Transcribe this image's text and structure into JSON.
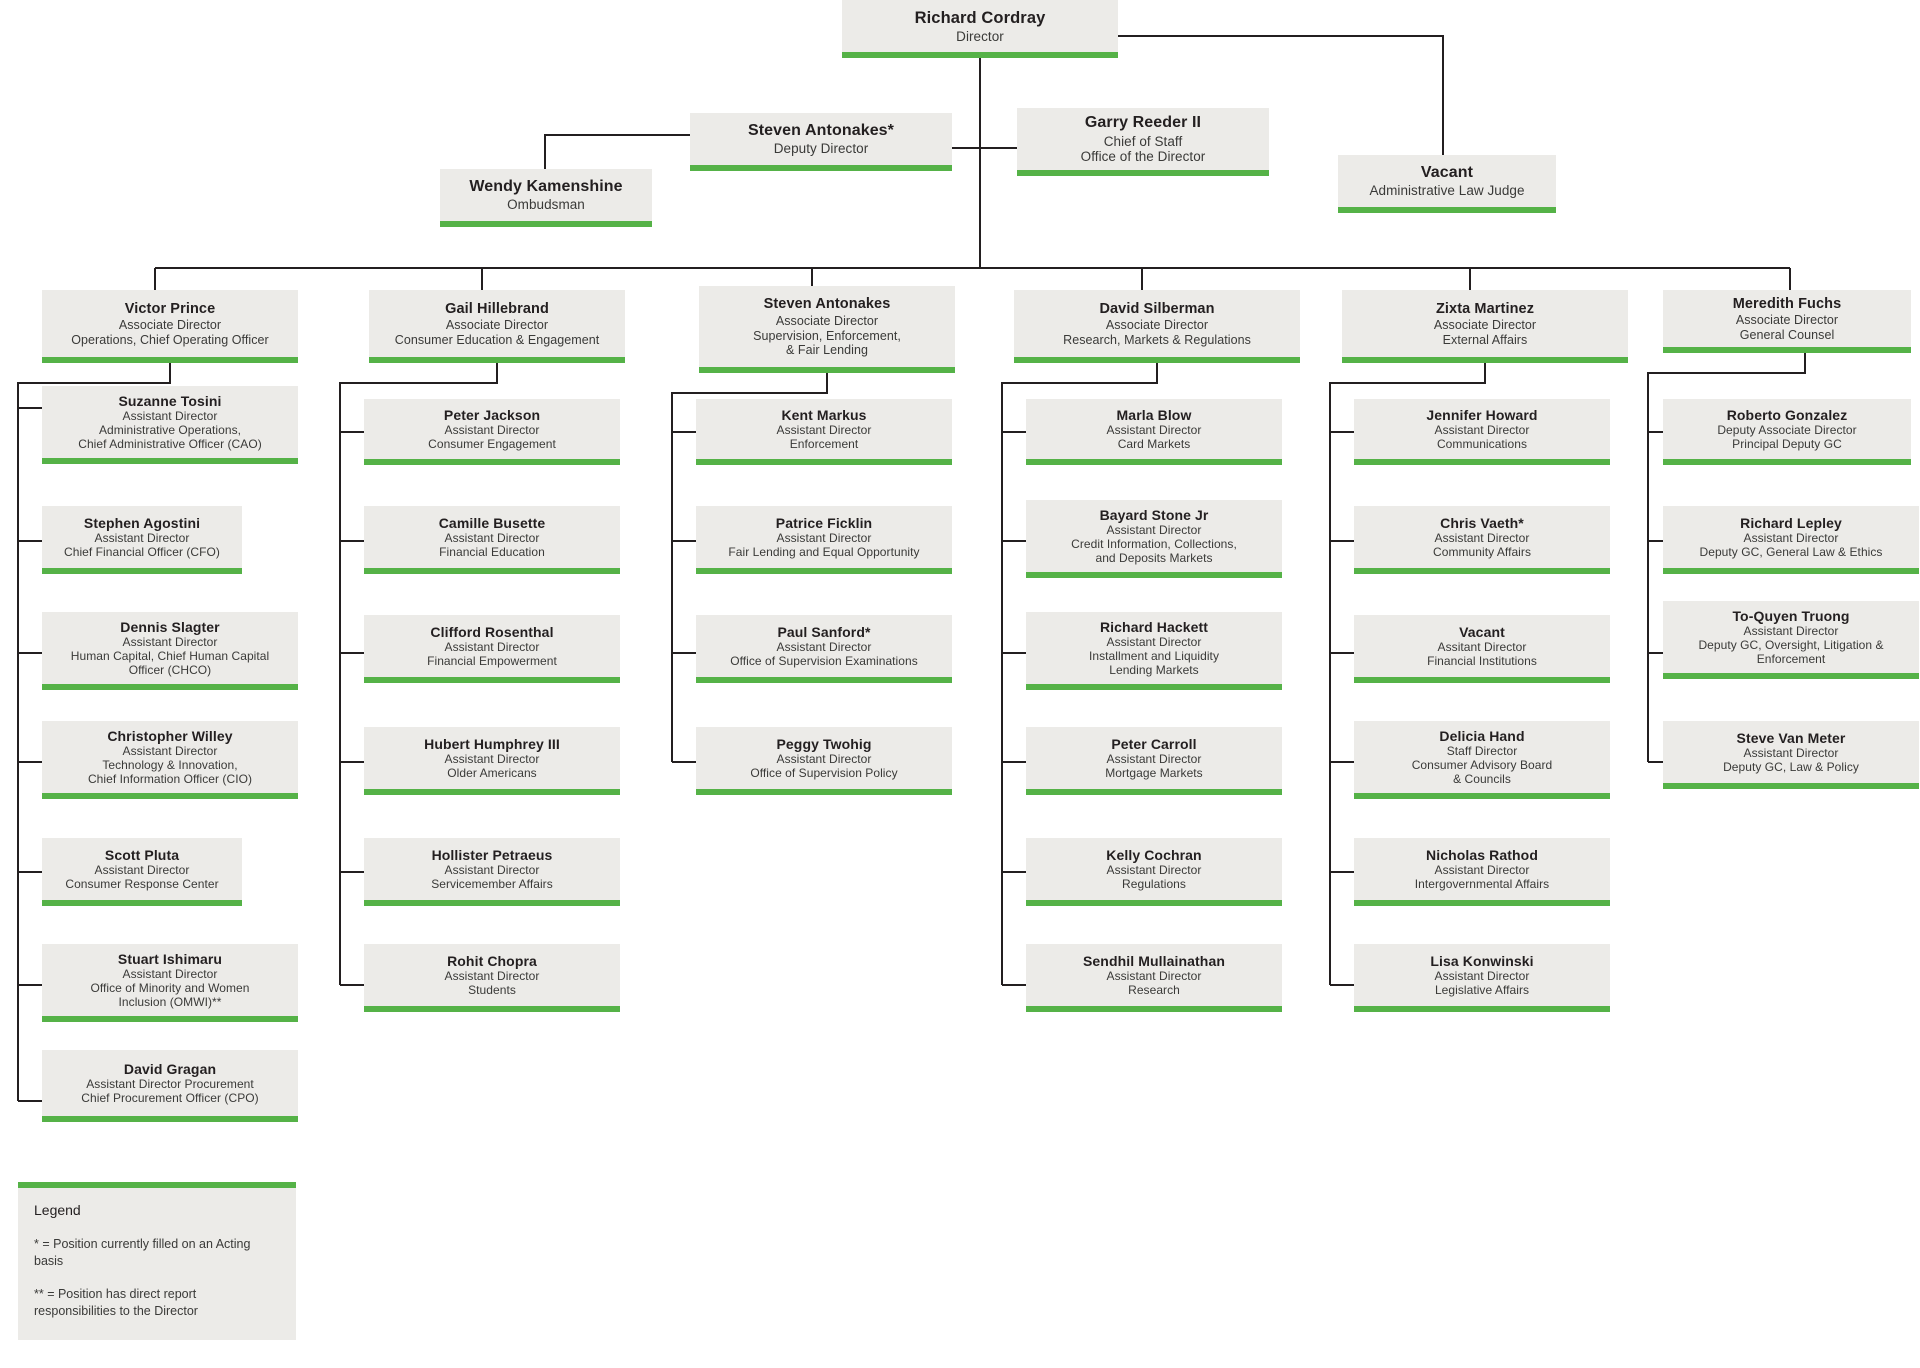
{
  "colors": {
    "node_fill": "#ecebe8",
    "accent_green": "#55b247",
    "text": "#231f20",
    "connector": "#231f20"
  },
  "director": {
    "name": "Richard Cordray",
    "title": "Director"
  },
  "deputy_director": {
    "name": "Steven Antonakes*",
    "title": "Deputy Director"
  },
  "chief_of_staff": {
    "name": "Garry Reeder II",
    "title": "Chief of Staff",
    "office": "Office of the Director"
  },
  "alj": {
    "name": "Vacant",
    "title": "Administrative Law Judge"
  },
  "ombudsman": {
    "name": "Wendy Kamenshine",
    "title": "Ombudsman"
  },
  "divisions": [
    {
      "head": {
        "name": "Victor Prince",
        "title": "Associate Director",
        "org": "Operations, Chief Operating Officer"
      },
      "reports": [
        {
          "name": "Suzanne Tosini",
          "title": "Assistant Director",
          "org": "Administrative Operations,",
          "org2": "Chief Administrative Officer (CAO)"
        },
        {
          "name": "Stephen Agostini",
          "title": "Assistant Director",
          "org": "Chief Financial Officer (CFO)"
        },
        {
          "name": "Dennis Slagter",
          "title": "Assistant Director",
          "org": "Human Capital, Chief Human Capital",
          "org2": "Officer (CHCO)"
        },
        {
          "name": "Christopher Willey",
          "title": "Assistant Director",
          "org": "Technology & Innovation,",
          "org2": "Chief Information Officer (CIO)"
        },
        {
          "name": "Scott Pluta",
          "title": "Assistant Director",
          "org": "Consumer Response Center"
        },
        {
          "name": "Stuart Ishimaru",
          "title": "Assistant Director",
          "org": "Office of Minority and Women",
          "org2": "Inclusion (OMWI)**"
        },
        {
          "name": "David Gragan",
          "title": "Assistant Director Procurement",
          "org": "Chief Procurement Officer (CPO)"
        }
      ]
    },
    {
      "head": {
        "name": "Gail Hillebrand",
        "title": "Associate Director",
        "org": "Consumer Education & Engagement"
      },
      "reports": [
        {
          "name": "Peter Jackson",
          "title": "Assistant Director",
          "org": "Consumer Engagement"
        },
        {
          "name": "Camille Busette",
          "title": "Assistant Director",
          "org": "Financial Education"
        },
        {
          "name": "Clifford Rosenthal",
          "title": "Assistant Director",
          "org": "Financial Empowerment"
        },
        {
          "name": "Hubert Humphrey III",
          "title": "Assistant Director",
          "org": "Older Americans"
        },
        {
          "name": "Hollister Petraeus",
          "title": "Assistant Director",
          "org": "Servicemember Affairs"
        },
        {
          "name": "Rohit Chopra",
          "title": "Assistant Director",
          "org": "Students"
        }
      ]
    },
    {
      "head": {
        "name": "Steven Antonakes",
        "title": "Associate Director",
        "org": "Supervision, Enforcement,",
        "org2": "& Fair Lending"
      },
      "reports": [
        {
          "name": "Kent Markus",
          "title": "Assistant Director",
          "org": "Enforcement"
        },
        {
          "name": "Patrice Ficklin",
          "title": "Assistant Director",
          "org": "Fair Lending and Equal Opportunity"
        },
        {
          "name": "Paul Sanford*",
          "title": "Assistant Director",
          "org": "Office of Supervision Examinations"
        },
        {
          "name": "Peggy Twohig",
          "title": "Assistant Director",
          "org": "Office of Supervision Policy"
        }
      ]
    },
    {
      "head": {
        "name": "David Silberman",
        "title": "Associate Director",
        "org": "Research, Markets & Regulations"
      },
      "reports": [
        {
          "name": "Marla Blow",
          "title": "Assistant Director",
          "org": "Card Markets"
        },
        {
          "name": "Bayard Stone Jr",
          "title": "Assistant Director",
          "org": "Credit Information, Collections,",
          "org2": "and Deposits Markets"
        },
        {
          "name": "Richard Hackett",
          "title": "Assistant Director",
          "org": "Installment and Liquidity",
          "org2": "Lending Markets"
        },
        {
          "name": "Peter Carroll",
          "title": "Assistant Director",
          "org": "Mortgage Markets"
        },
        {
          "name": "Kelly Cochran",
          "title": "Assistant Director",
          "org": "Regulations"
        },
        {
          "name": "Sendhil Mullainathan",
          "title": "Assistant Director",
          "org": "Research"
        }
      ]
    },
    {
      "head": {
        "name": "Zixta Martinez",
        "title": "Associate Director",
        "org": "External Affairs"
      },
      "reports": [
        {
          "name": "Jennifer Howard",
          "title": "Assistant Director",
          "org": "Communications"
        },
        {
          "name": "Chris Vaeth*",
          "title": "Assistant Director",
          "org": "Community Affairs"
        },
        {
          "name": "Vacant",
          "title": "Assitant Director",
          "org": "Financial Institutions"
        },
        {
          "name": "Delicia Hand",
          "title": "Staff Director",
          "org": "Consumer Advisory Board",
          "org2": "& Councils"
        },
        {
          "name": "Nicholas Rathod",
          "title": "Assistant Director",
          "org": "Intergovernmental Affairs"
        },
        {
          "name": "Lisa Konwinski",
          "title": "Assistant Director",
          "org": "Legislative Affairs"
        }
      ]
    },
    {
      "head": {
        "name": "Meredith Fuchs",
        "title": "Associate Director",
        "org": "General Counsel"
      },
      "reports": [
        {
          "name": "Roberto Gonzalez",
          "title": "Deputy Associate Director",
          "org": "Principal Deputy GC"
        },
        {
          "name": "Richard Lepley",
          "title": "Assistant Director",
          "org": "Deputy GC, General Law & Ethics"
        },
        {
          "name": "To-Quyen Truong",
          "title": "Assistant Director",
          "org": "Deputy GC, Oversight, Litigation &",
          "org2": "Enforcement"
        },
        {
          "name": "Steve Van Meter",
          "title": "Assistant Director",
          "org": "Deputy GC, Law & Policy"
        }
      ]
    }
  ],
  "legend": {
    "title": "Legend",
    "single_star": "* = Position currently filled on an Acting basis",
    "double_star": "** = Position has direct report responsibilities to the Director"
  }
}
